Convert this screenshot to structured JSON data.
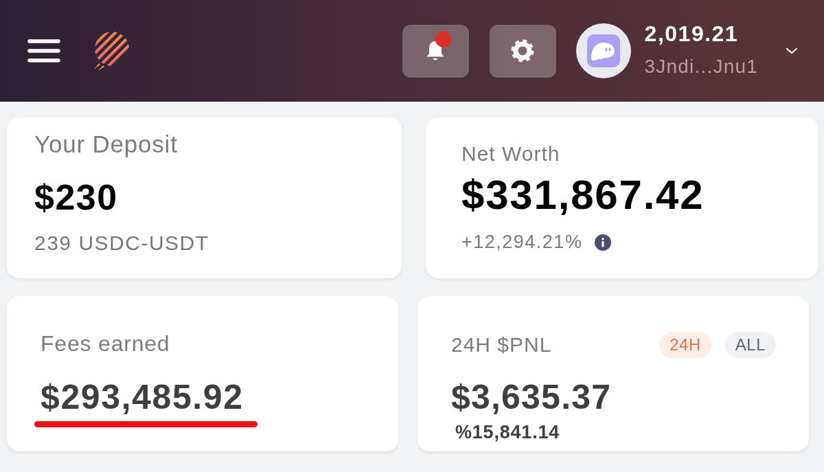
{
  "header": {
    "notifications": {
      "unread": true
    },
    "account": {
      "balance": "2,019.21",
      "address": "3Jndi...Jnu1"
    }
  },
  "cards": [
    {
      "kind": "stat",
      "label": "Your Deposit",
      "value": "$230",
      "sub": "239 USDC-USDT"
    },
    {
      "kind": "stat",
      "label": "Net Worth",
      "value": "$331,867.42",
      "sub": "+12,294.21%",
      "info": true
    },
    {
      "kind": "stat",
      "label": "Fees earned",
      "value": "$293,485.92",
      "underlined": true
    },
    {
      "kind": "pnl",
      "label": "24H $PNL",
      "value": "$3,635.37",
      "sub": "%15,841.14",
      "periods": [
        {
          "label": "24H",
          "selected": true
        },
        {
          "label": "ALL",
          "selected": false
        }
      ]
    }
  ]
}
